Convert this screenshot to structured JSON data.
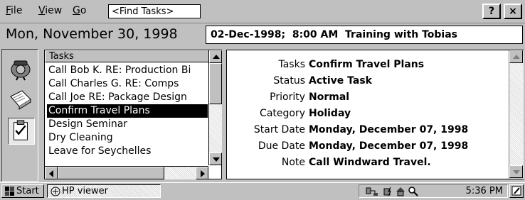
{
  "menubar": {
    "file_label": "File",
    "view_label": "View",
    "go_label": "Go",
    "find_placeholder": "<Find Tasks>",
    "help_label": "?",
    "close_label": "×"
  },
  "datebar": {
    "current_date": "Mon, November 30, 1998",
    "next_appointment": "02-Dec-1998;  8:00 AM  Training with Tobias"
  },
  "sidebar": {
    "icons": [
      "calendar-icon",
      "contacts-icon",
      "tasks-icon"
    ]
  },
  "tasks": {
    "header": "Tasks",
    "items": [
      {
        "label": "Call Bob K. RE: Production Bi"
      },
      {
        "label": "Call Charles G. RE: Comps"
      },
      {
        "label": "Call Joe RE: Package Design"
      },
      {
        "label": "Confirm Travel Plans",
        "selected": true
      },
      {
        "label": "Design Seminar"
      },
      {
        "label": "Dry Cleaning"
      },
      {
        "label": "Leave for Seychelles"
      }
    ]
  },
  "details": {
    "rows": [
      {
        "label": "Tasks",
        "value": "Confirm Travel Plans"
      },
      {
        "label": "Status",
        "value": "Active Task"
      },
      {
        "label": "Priority",
        "value": "Normal"
      },
      {
        "label": "Category",
        "value": "Holiday"
      },
      {
        "label": "Start Date",
        "value": "Monday, December 07, 1998"
      },
      {
        "label": "Due Date",
        "value": "Monday, December 07, 1998"
      },
      {
        "label": "Note",
        "value": "Call Windward Travel."
      }
    ]
  },
  "taskbar": {
    "start_label": "Start",
    "window_label": "HP viewer",
    "clock": "5:36 PM"
  }
}
